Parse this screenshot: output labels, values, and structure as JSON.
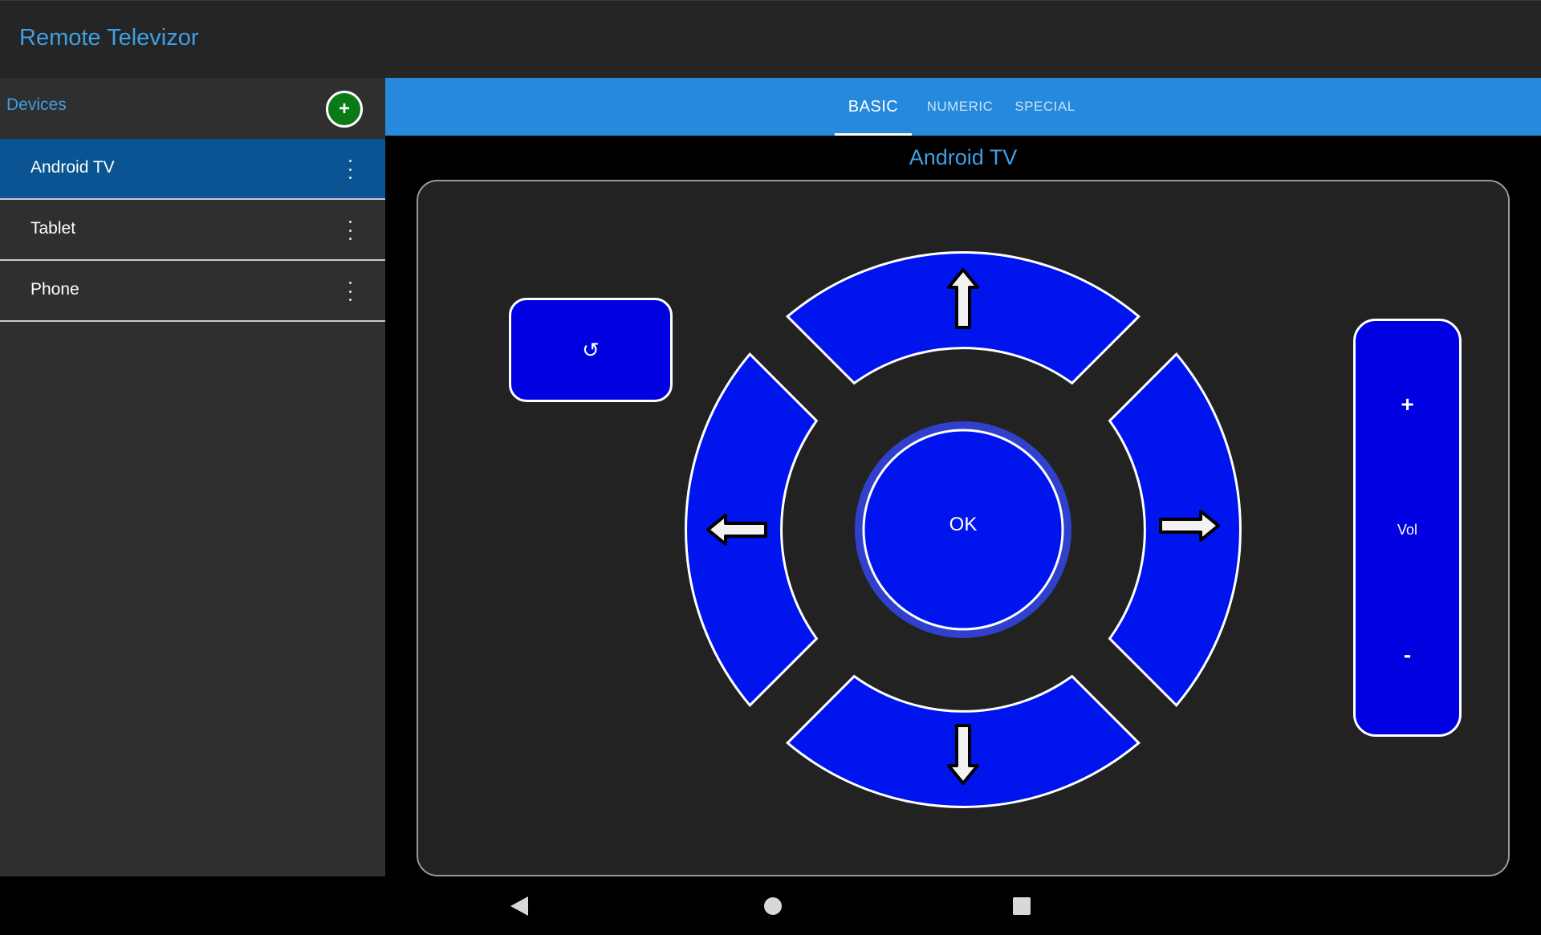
{
  "app": {
    "title": "Remote Televizor"
  },
  "sidebar": {
    "header_label": "Devices",
    "add_label": "+",
    "items": [
      {
        "label": "Android TV",
        "selected": true
      },
      {
        "label": "Tablet",
        "selected": false
      },
      {
        "label": "Phone",
        "selected": false
      }
    ]
  },
  "tabs": [
    {
      "label": "BASIC",
      "active": true
    },
    {
      "label": "NUMERIC",
      "active": false
    },
    {
      "label": "SPECIAL",
      "active": false
    }
  ],
  "remote": {
    "device_title": "Android TV",
    "back_symbol": "↺",
    "ok_label": "OK",
    "volume": {
      "plus": "+",
      "label": "Vol",
      "minus": "-"
    }
  },
  "colors": {
    "button_blue": "#0000e0",
    "accent": "#3f9fe6",
    "tabbar": "#2589dc",
    "selected_item": "#0a5494",
    "add_button": "#0a7a16"
  },
  "icons": {
    "nav_back": "triangle-left-icon",
    "nav_home": "circle-icon",
    "nav_recents": "square-icon"
  }
}
